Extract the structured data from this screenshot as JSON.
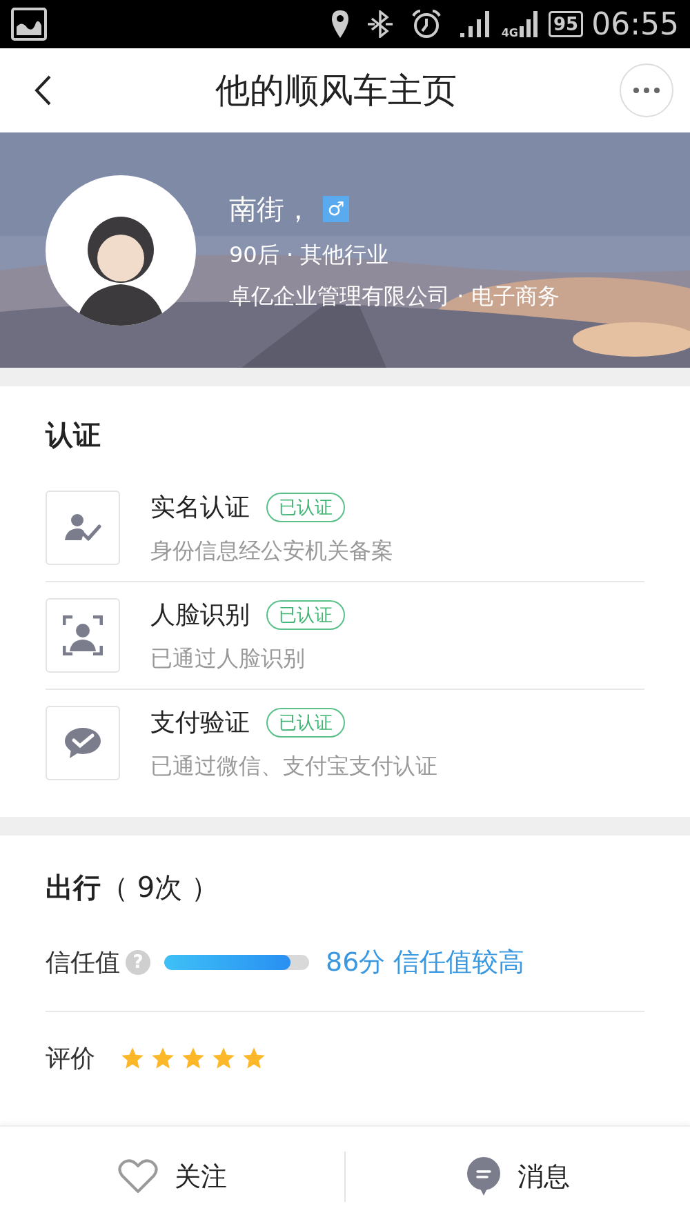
{
  "status_bar": {
    "battery": "95",
    "network": "4G",
    "time": "06:55"
  },
  "header": {
    "title": "他的顺风车主页"
  },
  "profile": {
    "name": "南街，",
    "gender": "♂",
    "line_1": "90后 · 其他行业",
    "line_2": "卓亿企业管理有限公司 · 电子商务"
  },
  "verification": {
    "title": "认证",
    "items": [
      {
        "kind": "id",
        "title": "实名认证",
        "badge": "已认证",
        "verified": true,
        "description": "身份信息经公安机关备案"
      },
      {
        "kind": "face",
        "title": "人脸识别",
        "badge": "已认证",
        "verified": true,
        "description": "已通过人脸识别"
      },
      {
        "kind": "pay",
        "title": "支付验证",
        "badge": "已认证",
        "verified": true,
        "description": "已通过微信、支付宝支付认证"
      }
    ]
  },
  "travel": {
    "title": "出行",
    "count": "（ 9次 ）",
    "trust": {
      "label": "信任值",
      "help": "?",
      "level": 0.87,
      "reading": "86分 信任值较高"
    },
    "rating": {
      "label": "评价",
      "stars": 5
    }
  },
  "bottom_bar": {
    "buttons": [
      {
        "kind": "follow",
        "label": "关注"
      },
      {
        "kind": "message",
        "label": "消息"
      }
    ]
  }
}
